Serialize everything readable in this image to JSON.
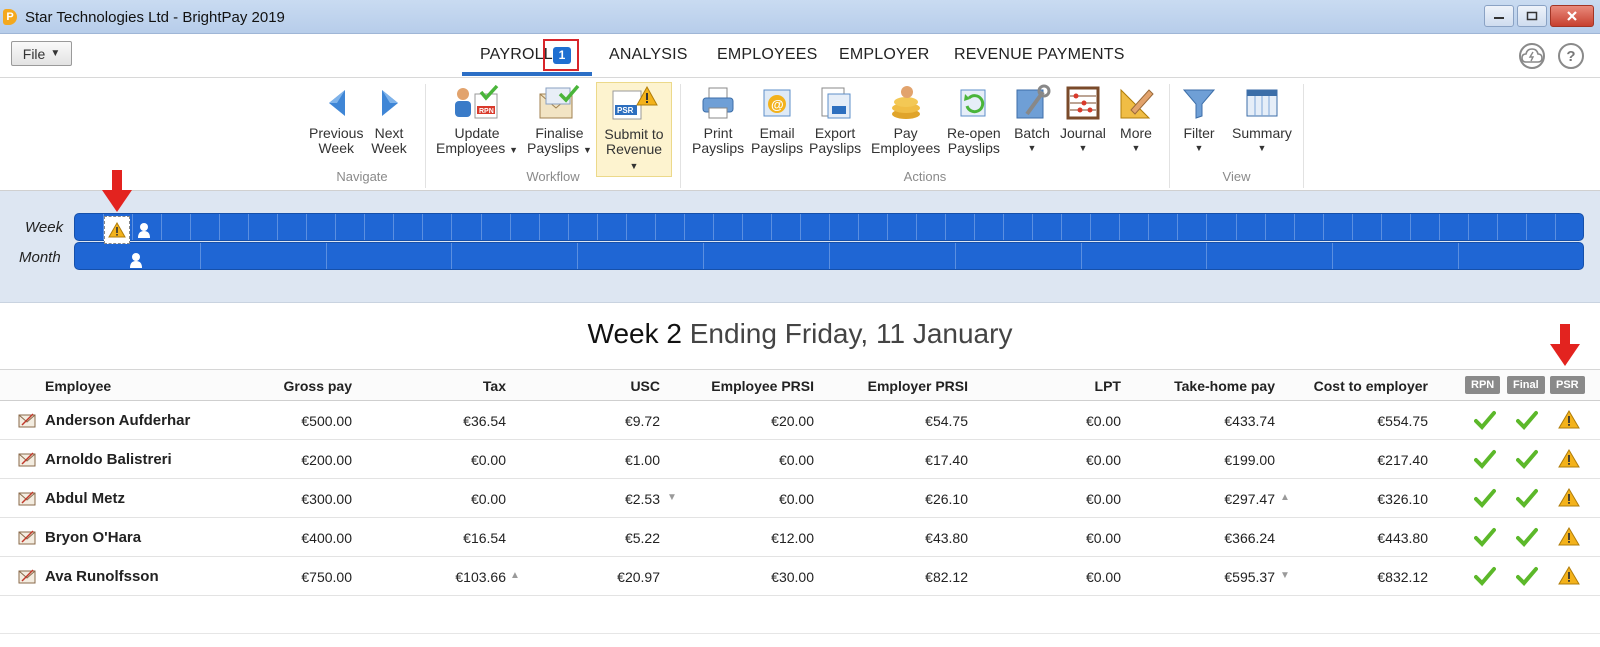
{
  "window": {
    "title": "Star Technologies Ltd - BrightPay 2019"
  },
  "file_menu": {
    "label": "File"
  },
  "tabs": [
    {
      "label": "PAYROLL"
    },
    {
      "label": "ANALYSIS"
    },
    {
      "label": "EMPLOYEES"
    },
    {
      "label": "EMPLOYER"
    },
    {
      "label": "REVENUE PAYMENTS"
    }
  ],
  "payroll_badge": "1",
  "ribbon": {
    "groups": {
      "navigate": "Navigate",
      "workflow": "Workflow",
      "actions": "Actions",
      "view": "View"
    },
    "buttons": {
      "previous_week": [
        "Previous",
        "Week"
      ],
      "next_week": [
        "Next",
        "Week"
      ],
      "update_employees": [
        "Update",
        "Employees"
      ],
      "finalise_payslips": [
        "Finalise",
        "Payslips"
      ],
      "submit_to_revenue": [
        "Submit to",
        "Revenue"
      ],
      "print_payslips": [
        "Print",
        "Payslips"
      ],
      "email_payslips": [
        "Email",
        "Payslips"
      ],
      "export_payslips": [
        "Export",
        "Payslips"
      ],
      "pay_employees": [
        "Pay",
        "Employees"
      ],
      "reopen_payslips": [
        "Re-open",
        "Payslips"
      ],
      "batch": "Batch",
      "journal": "Journal",
      "more": "More",
      "filter": "Filter",
      "summary": "Summary"
    }
  },
  "period_selector": {
    "week_label": "Week",
    "month_label": "Month"
  },
  "heading": {
    "main": "Week 2",
    "sub": "Ending Friday, 11 January"
  },
  "table": {
    "columns": [
      "Employee",
      "Gross pay",
      "Tax",
      "USC",
      "Employee PRSI",
      "Employer PRSI",
      "LPT",
      "Take-home pay",
      "Cost to employer"
    ],
    "status_columns": [
      "RPN",
      "Final",
      "PSR"
    ],
    "rows": [
      {
        "name": "Anderson Aufderhar",
        "gross": "€500.00",
        "tax": "€36.54",
        "usc": "€9.72",
        "ee_prsi": "€20.00",
        "er_prsi": "€54.75",
        "lpt": "€0.00",
        "take_home": "€433.74",
        "cost": "€554.75"
      },
      {
        "name": "Arnoldo Balistreri",
        "gross": "€200.00",
        "tax": "€0.00",
        "usc": "€1.00",
        "ee_prsi": "€0.00",
        "er_prsi": "€17.40",
        "lpt": "€0.00",
        "take_home": "€199.00",
        "cost": "€217.40"
      },
      {
        "name": "Abdul Metz",
        "gross": "€300.00",
        "tax": "€0.00",
        "usc": "€2.53",
        "ee_prsi": "€0.00",
        "er_prsi": "€26.10",
        "lpt": "€0.00",
        "take_home": "€297.47",
        "cost": "€326.10"
      },
      {
        "name": "Bryon O'Hara",
        "gross": "€400.00",
        "tax": "€16.54",
        "usc": "€5.22",
        "ee_prsi": "€12.00",
        "er_prsi": "€43.80",
        "lpt": "€0.00",
        "take_home": "€366.24",
        "cost": "€443.80"
      },
      {
        "name": "Ava Runolfsson",
        "gross": "€750.00",
        "tax": "€103.66",
        "usc": "€20.97",
        "ee_prsi": "€30.00",
        "er_prsi": "€82.12",
        "lpt": "€0.00",
        "take_home": "€595.37",
        "cost": "€832.12"
      }
    ]
  },
  "colors": {
    "accent": "#2c6fc6",
    "strip": "#1f66d4",
    "check": "#5cb82a",
    "warn": "#f3b21b",
    "annotation": "#e3231f"
  }
}
